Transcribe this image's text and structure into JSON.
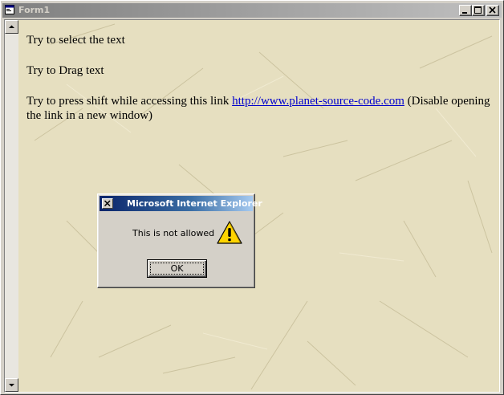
{
  "window": {
    "title": "Form1",
    "caption_buttons": [
      "minimize-icon",
      "maximize-icon",
      "close-icon"
    ]
  },
  "page": {
    "line1": "Try to select the text",
    "line2": "Try to Drag text",
    "line3_prefix": "Try to press shift while accessing this link",
    "link_text": "http://www.planet-source-code.com",
    "line3_suffix": "(Disable opening the link in a new window)"
  },
  "dialog": {
    "title": "Microsoft Internet Explorer",
    "message": "This is not allowed",
    "icon": "warning-icon",
    "ok_label": "OK"
  },
  "scrollbar": {
    "up_icon": "arrow-up-icon",
    "down_icon": "arrow-down-icon"
  },
  "colors": {
    "page_background": "#e6dfc0",
    "dialog_title_start": "#0a246a",
    "dialog_title_end": "#a6caf0",
    "link": "#0000cc"
  }
}
